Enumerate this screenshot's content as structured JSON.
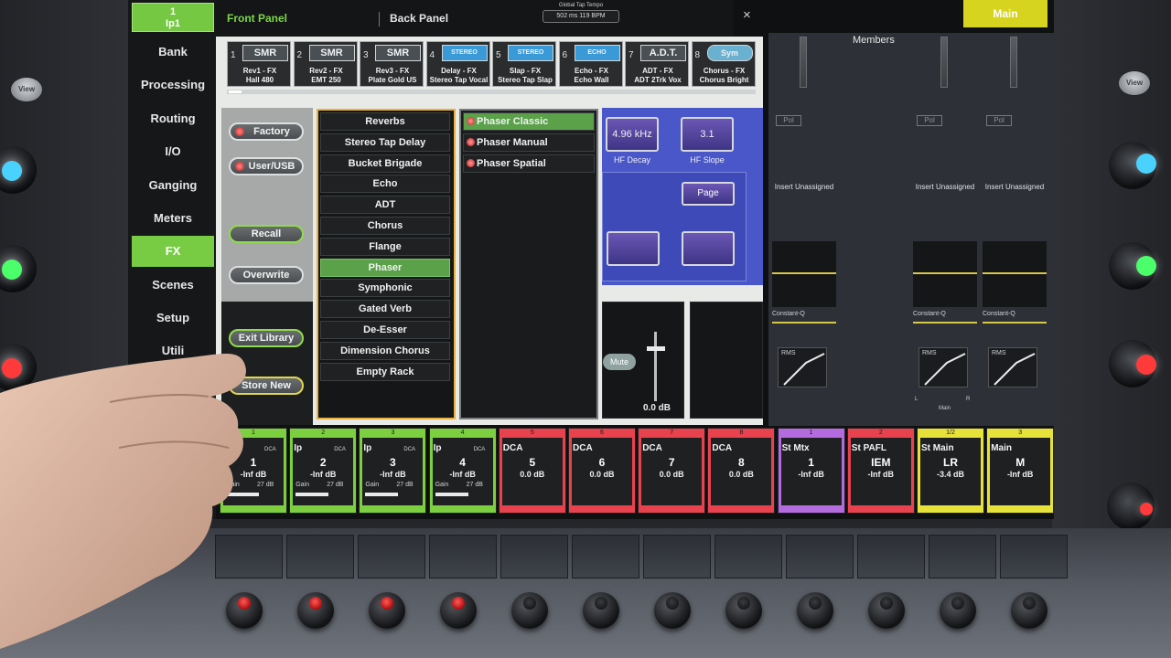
{
  "nav": {
    "top": {
      "line1": "1",
      "line2": "Ip1"
    },
    "items": [
      "Bank",
      "Processing",
      "Routing",
      "I/O",
      "Ganging",
      "Meters",
      "FX",
      "Scenes",
      "Setup",
      "Utili"
    ],
    "active": "FX"
  },
  "header": {
    "tabs": [
      {
        "label": "Front Panel"
      },
      {
        "label": "Back Panel"
      }
    ],
    "tempo_title": "Global Tap Tempo",
    "tempo_value": "502 ms   119 BPM",
    "close": "×"
  },
  "racks": [
    {
      "num": "1",
      "logo": "SMR",
      "line1": "Rev1 - FX",
      "line2": "Hall 480"
    },
    {
      "num": "2",
      "logo": "SMR",
      "line1": "Rev2 - FX",
      "line2": "EMT 250"
    },
    {
      "num": "3",
      "logo": "SMR",
      "line1": "Rev3 - FX",
      "line2": "Plate Gold US"
    },
    {
      "num": "4",
      "logo": "STEREO",
      "line1": "Delay - FX",
      "line2": "Stereo Tap Vocal"
    },
    {
      "num": "5",
      "logo": "STEREO",
      "line1": "Slap - FX",
      "line2": "Stereo Tap Slap"
    },
    {
      "num": "6",
      "logo": "ECHO",
      "line1": "Echo - FX",
      "line2": "Echo Wall"
    },
    {
      "num": "7",
      "logo": "A.D.T.",
      "line1": "ADT - FX",
      "line2": "ADT 2Trk Vox"
    },
    {
      "num": "8",
      "logo": "Sym",
      "line1": "Chorus - FX",
      "line2": "Chorus Bright"
    }
  ],
  "library": {
    "factory": "Factory",
    "user_usb": "User/USB",
    "recall": "Recall",
    "overwrite": "Overwrite",
    "exit_library": "Exit Library",
    "store_new": "Store New"
  },
  "categories": [
    "Reverbs",
    "Stereo Tap Delay",
    "Bucket Brigade",
    "Echo",
    "ADT",
    "Chorus",
    "Flange",
    "Phaser",
    "Symphonic",
    "Gated Verb",
    "De-Esser",
    "Dimension Chorus",
    "Empty Rack"
  ],
  "category_active": "Phaser",
  "presets": [
    "Phaser Classic",
    "Phaser Manual",
    "Phaser Spatial"
  ],
  "preset_active": "Phaser Classic",
  "params": {
    "hf_decay_value": "4.96 kHz",
    "hf_decay_label": "HF Decay",
    "hf_slope_value": "3.1",
    "hf_slope_label": "HF Slope",
    "page": "Page"
  },
  "fx_fader": {
    "mute": "Mute",
    "level": "0.0 dB"
  },
  "mixer": {
    "members": "Members",
    "main_tab": "Main",
    "pol": "Pol",
    "insert": "Insert Unassigned",
    "constant_q": "Constant-Q",
    "rms": "RMS",
    "lr": {
      "l": "L",
      "r": "R",
      "main": "Main"
    }
  },
  "channels": [
    {
      "head": "1",
      "name": "",
      "num": "1",
      "db": "-Inf dB",
      "dca": "DCA",
      "gain": "Gain",
      "gain_val": "27 dB",
      "color": "#7ccf3e"
    },
    {
      "head": "2",
      "name": "Ip",
      "num": "2",
      "db": "-Inf dB",
      "dca": "DCA",
      "gain": "Gain",
      "gain_val": "27 dB",
      "color": "#7ccf3e"
    },
    {
      "head": "3",
      "name": "Ip",
      "num": "3",
      "db": "-Inf dB",
      "dca": "DCA",
      "gain": "Gain",
      "gain_val": "27 dB",
      "color": "#7ccf3e"
    },
    {
      "head": "4",
      "name": "Ip",
      "num": "4",
      "db": "-Inf dB",
      "dca": "DCA",
      "gain": "Gain",
      "gain_val": "27 dB",
      "color": "#7ccf3e"
    },
    {
      "head": "5",
      "name": "DCA",
      "num": "5",
      "db": "0.0 dB",
      "dca": "",
      "gain": "",
      "gain_val": "",
      "color": "#e8424e"
    },
    {
      "head": "6",
      "name": "DCA",
      "num": "6",
      "db": "0.0 dB",
      "dca": "",
      "gain": "",
      "gain_val": "",
      "color": "#e8424e"
    },
    {
      "head": "7",
      "name": "DCA",
      "num": "7",
      "db": "0.0 dB",
      "dca": "",
      "gain": "",
      "gain_val": "",
      "color": "#e8424e"
    },
    {
      "head": "8",
      "name": "DCA",
      "num": "8",
      "db": "0.0 dB",
      "dca": "",
      "gain": "",
      "gain_val": "",
      "color": "#e8424e"
    },
    {
      "head": "1",
      "name": "St Mtx",
      "num": "1",
      "db": "-Inf dB",
      "dca": "",
      "gain": "",
      "gain_val": "",
      "color": "#b56be0"
    },
    {
      "head": "2",
      "name": "St PAFL",
      "num": "IEM",
      "db": "-Inf dB",
      "dca": "",
      "gain": "",
      "gain_val": "",
      "color": "#e8424e"
    },
    {
      "head": "1/2",
      "name": "St Main",
      "num": "LR",
      "db": "-3.4 dB",
      "dca": "",
      "gain": "",
      "gain_val": "",
      "color": "#e6e23a"
    },
    {
      "head": "3",
      "name": "Main",
      "num": "M",
      "db": "-Inf dB",
      "dca": "",
      "gain": "",
      "gain_val": "",
      "color": "#e6e23a"
    }
  ],
  "hardware": {
    "view_left": "View",
    "view_right": "View"
  }
}
